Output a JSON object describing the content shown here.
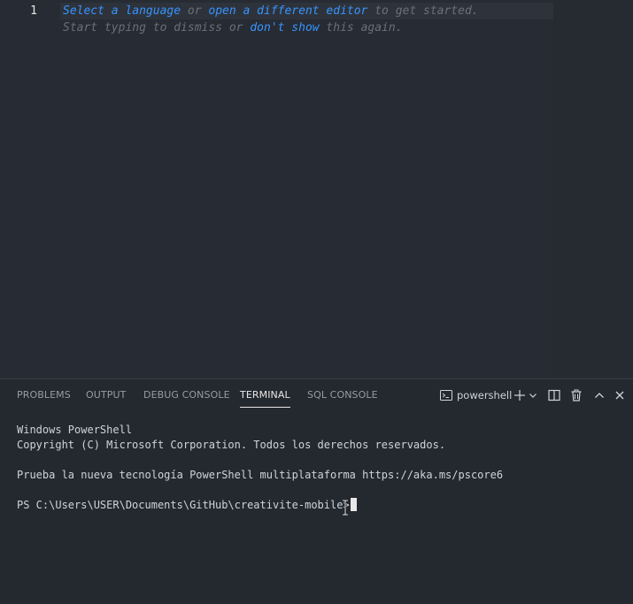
{
  "editor": {
    "line_number": "1",
    "hint_line1": {
      "link1": "Select a language",
      "text1": " or ",
      "link2": "open a different editor",
      "text2": " to get started."
    },
    "hint_line2": {
      "text1": "Start typing to dismiss or ",
      "link1": "don't show",
      "text2": " this again."
    }
  },
  "panel": {
    "tabs": [
      {
        "label": "PROBLEMS"
      },
      {
        "label": "OUTPUT"
      },
      {
        "label": "DEBUG CONSOLE"
      },
      {
        "label": "TERMINAL",
        "active": true
      },
      {
        "label": "SQL CONSOLE"
      }
    ],
    "terminal_selector": {
      "label": "powershell",
      "icon": "terminal-icon"
    },
    "actions": [
      {
        "icon": "plus-icon"
      },
      {
        "icon": "chevron-down-icon"
      },
      {
        "icon": "split-icon"
      },
      {
        "icon": "trash-icon"
      },
      {
        "icon": "chevron-up-icon"
      },
      {
        "icon": "close-icon"
      }
    ]
  },
  "terminal": {
    "lines": [
      "Windows PowerShell",
      "Copyright (C) Microsoft Corporation. Todos los derechos reservados.",
      "",
      "Prueba la nueva tecnología PowerShell multiplataforma https://aka.ms/pscore6",
      ""
    ],
    "prompt": "PS C:\\Users\\USER\\Documents\\GitHub\\creativite-mobile>"
  },
  "colors": {
    "editor_bg": "#272b33",
    "panel_bg": "#24282f",
    "link": "#3794ff",
    "hint_text": "#6a7079",
    "active_tab": "#e8e8e8",
    "inactive_tab": "#979ca5"
  }
}
